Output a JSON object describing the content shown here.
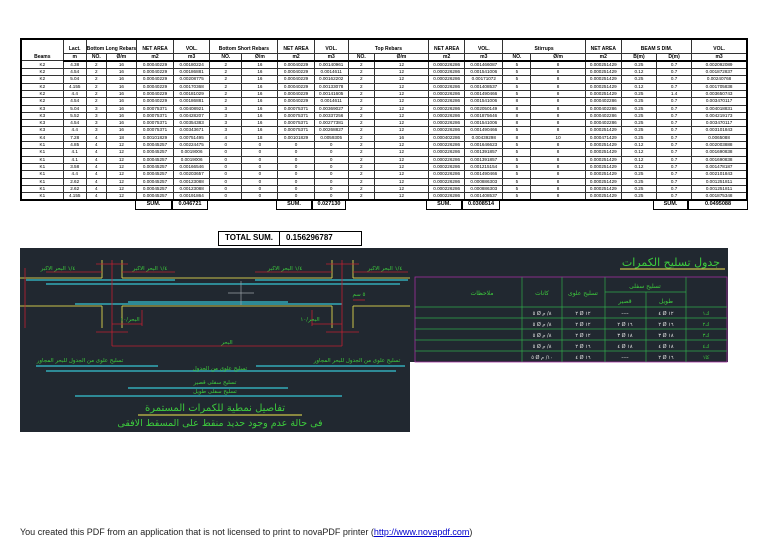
{
  "table": {
    "header1": [
      "Beams",
      "Lact.",
      "Bottom Long Rebars",
      "NET AREA",
      "VOL.",
      "Bottom Short Rebars",
      "NET AREA",
      "VOL.",
      "Top Rebars",
      "NET AREA",
      "VOL.",
      "Stirrups",
      "NET AREA",
      "BEAM S DIM.",
      "VOL."
    ],
    "header2": [
      "m",
      "NO.",
      "Ø/m",
      "m2",
      "m3",
      "NO.",
      "Ø/m",
      "m2",
      "m3",
      "NO.",
      "Ø/m",
      "m2",
      "m3",
      "NO.",
      "Ø/m",
      "m2",
      "B(m)",
      "D(m)",
      "m3"
    ],
    "rows": [
      [
        "K2",
        "4.38",
        "2",
        "16",
        "0.00040229",
        "0.00180224",
        "2",
        "16",
        "0.00040229",
        "0.00140961",
        "2",
        "12",
        "0.000226286",
        "0.001466087",
        "5",
        "8",
        "0.000251429",
        "0.25",
        "0.7",
        "0.002092089"
      ],
      [
        "K2",
        "4.54",
        "2",
        "16",
        "0.00040229",
        "0.00186881",
        "2",
        "16",
        "0.00040229",
        "0.0014611",
        "2",
        "12",
        "0.000226286",
        "0.001541006",
        "5",
        "8",
        "0.000251429",
        "0.12",
        "0.7",
        "0.001872837"
      ],
      [
        "K2",
        "5.04",
        "2",
        "16",
        "0.00040229",
        "0.00208775",
        "2",
        "16",
        "0.00040229",
        "0.00162202",
        "2",
        "12",
        "0.000226286",
        "0.00171072",
        "5",
        "8",
        "0.000251429",
        "0.25",
        "0.7",
        "0.00240768"
      ],
      [
        "K2",
        "4.155",
        "2",
        "16",
        "0.00040229",
        "0.00170368",
        "2",
        "16",
        "0.00040229",
        "0.00133078",
        "2",
        "12",
        "0.000226286",
        "0.001408537",
        "5",
        "8",
        "0.000251429",
        "0.12",
        "0.7",
        "0.001705838"
      ],
      [
        "K2",
        "4.4",
        "2",
        "16",
        "0.00040229",
        "0.00181029",
        "2",
        "16",
        "0.00040229",
        "0.00141605",
        "2",
        "12",
        "0.000226286",
        "0.001490466",
        "5",
        "8",
        "0.000251429",
        "0.25",
        "1.4",
        "0.003650743"
      ],
      [
        "K2",
        "4.54",
        "2",
        "16",
        "0.00040229",
        "0.00186881",
        "2",
        "16",
        "0.00040229",
        "0.0014611",
        "2",
        "12",
        "0.000226286",
        "0.001541006",
        "8",
        "8",
        "0.000402286",
        "0.25",
        "0.7",
        "0.003470117"
      ],
      [
        "K3",
        "5.04",
        "3",
        "16",
        "0.00075371",
        "0.00408921",
        "3",
        "16",
        "0.00075371",
        "0.00369027",
        "2",
        "12",
        "0.000226286",
        "0.002050149",
        "8",
        "8",
        "0.000402286",
        "0.25",
        "0.7",
        "0.004018831"
      ],
      [
        "K3",
        "5.52",
        "3",
        "16",
        "0.00075371",
        "0.00428207",
        "3",
        "16",
        "0.00075371",
        "0.00337256",
        "2",
        "12",
        "0.000226286",
        "0.001875646",
        "8",
        "8",
        "0.000402286",
        "0.25",
        "0.7",
        "0.004219173"
      ],
      [
        "K3",
        "4.54",
        "3",
        "16",
        "0.00075371",
        "0.00354383",
        "3",
        "16",
        "0.00075371",
        "0.00277381",
        "2",
        "12",
        "0.000226286",
        "0.001541006",
        "8",
        "8",
        "0.000402286",
        "0.25",
        "0.7",
        "0.003470117"
      ],
      [
        "K3",
        "4.4",
        "3",
        "16",
        "0.00075371",
        "0.00343671",
        "3",
        "16",
        "0.00075371",
        "0.00268827",
        "2",
        "12",
        "0.000226286",
        "0.001490466",
        "5",
        "8",
        "0.000251429",
        "0.25",
        "0.7",
        "0.003101843"
      ],
      [
        "K4",
        "7.28",
        "4",
        "18",
        "0.00101829",
        "0.00751495",
        "4",
        "18",
        "0.00101829",
        "0.0059305",
        "2",
        "16",
        "0.000402286",
        "0.00439298",
        "8",
        "10",
        "0.000471429",
        "0.25",
        "0.7",
        "0.0065088"
      ],
      [
        "K1",
        "4.85",
        "4",
        "12",
        "0.00045257",
        "0.00224475",
        "0",
        "0",
        "0",
        "0",
        "2",
        "12",
        "0.000226286",
        "0.001646623",
        "5",
        "8",
        "0.000251429",
        "0.12",
        "0.7",
        "0.002003888"
      ],
      [
        "K1",
        "4.1",
        "4",
        "12",
        "0.00045257",
        "0.0019006",
        "0",
        "0",
        "0",
        "0",
        "2",
        "12",
        "0.000226286",
        "0.001391857",
        "5",
        "8",
        "0.000251429",
        "0.12",
        "0.7",
        "0.001690838"
      ],
      [
        "K1",
        "4.1",
        "4",
        "12",
        "0.00045257",
        "0.0019006",
        "0",
        "0",
        "0",
        "0",
        "2",
        "12",
        "0.000226286",
        "0.001391857",
        "5",
        "8",
        "0.000251429",
        "0.12",
        "0.7",
        "0.001690838"
      ],
      [
        "K1",
        "3.58",
        "4",
        "12",
        "0.00045257",
        "0.00166546",
        "0",
        "0",
        "0",
        "0",
        "2",
        "12",
        "0.000226286",
        "0.001215154",
        "5",
        "8",
        "0.000251429",
        "0.12",
        "0.7",
        "0.001478187"
      ],
      [
        "K1",
        "4.4",
        "4",
        "12",
        "0.00045257",
        "0.00203657",
        "0",
        "0",
        "0",
        "0",
        "2",
        "12",
        "0.000226286",
        "0.001490466",
        "5",
        "8",
        "0.000251429",
        "0.25",
        "0.7",
        "0.002101843"
      ],
      [
        "K1",
        "2.62",
        "4",
        "12",
        "0.00045257",
        "0.00123088",
        "0",
        "0",
        "0",
        "0",
        "2",
        "12",
        "0.000226286",
        "0.000886303",
        "5",
        "8",
        "0.000251429",
        "0.25",
        "0.7",
        "0.001251811"
      ],
      [
        "K1",
        "2.62",
        "4",
        "12",
        "0.00045257",
        "0.00123088",
        "0",
        "0",
        "0",
        "0",
        "2",
        "12",
        "0.000226286",
        "0.000886303",
        "5",
        "8",
        "0.000251429",
        "0.25",
        "0.7",
        "0.001251811"
      ],
      [
        "K1",
        "4.155",
        "4",
        "12",
        "0.00045257",
        "0.00191864",
        "0",
        "0",
        "0",
        "0",
        "2",
        "12",
        "0.000226286",
        "0.001408537",
        "5",
        "8",
        "0.000251429",
        "0.25",
        "0.7",
        "0.001875348"
      ]
    ],
    "sum_label": "SUM.",
    "sums": [
      "0.046721",
      "0.027130",
      "0.0308514",
      "0.0495088"
    ],
    "total_label": "TOTAL SUM.",
    "total_value": "0.156296787"
  },
  "drawing": {
    "quarter_span": "١/٤ البحر الاكبر",
    "five_cm": "٥ سم",
    "span_tenth": "البحر/١٠",
    "span": "البحر",
    "top_adjacent": "تسليح علوى من الجدول للبحر المجاور",
    "top_from_table": "تسليح علوى من الجدول",
    "bottom_short": "تسليح سفلى قصير",
    "bottom_long": "تسليح سفلى طويل",
    "title": "تفاصيل نمطية للكمرات المستمرة",
    "subtitle": "فى حالة عدم وجود حديد منقط على المسقط الافقى"
  },
  "schedule": {
    "title": "جدول تسليح الكمرات",
    "col_bottom": "تسليح سفلى",
    "col_long": "طويل",
    "col_short": "قصير",
    "col_top": "تسليح علوى",
    "col_stirrups": "كانات",
    "col_notes": "ملاحظات",
    "rows": [
      {
        "beam": "ك١",
        "long": "٤ Ø ١٢",
        "short": "----",
        "top": "٢ Ø ١٢",
        "stirrups": "٥ Ø ٨/ م"
      },
      {
        "beam": "ك٢",
        "long": "٢ Ø ١٦",
        "short": "٢ Ø ١٦",
        "top": "٢ Ø ١٢",
        "stirrups": "٥ Ø ٨/ م"
      },
      {
        "beam": "ك٣",
        "long": "٣ Ø ١٨",
        "short": "٣ Ø ١٨",
        "top": "٢ Ø ١٢",
        "stirrups": "٥ Ø ٨/ م"
      },
      {
        "beam": "ك٤",
        "long": "٤ Ø ١٨",
        "short": "٤ Ø ١٨",
        "top": "٢ Ø ١٦",
        "stirrups": "٥ Ø ٨/ م"
      },
      {
        "beam": "كا١",
        "long": "٢ Ø ١٦",
        "short": "----",
        "top": "٤ Ø ١٦",
        "stirrups": "٥ Ø ١٠/ م"
      }
    ]
  },
  "footer": {
    "text": "You created this PDF from an application that is not licensed to print to novaPDF printer (",
    "link": "http://www.novapdf.com",
    "close": ")"
  }
}
